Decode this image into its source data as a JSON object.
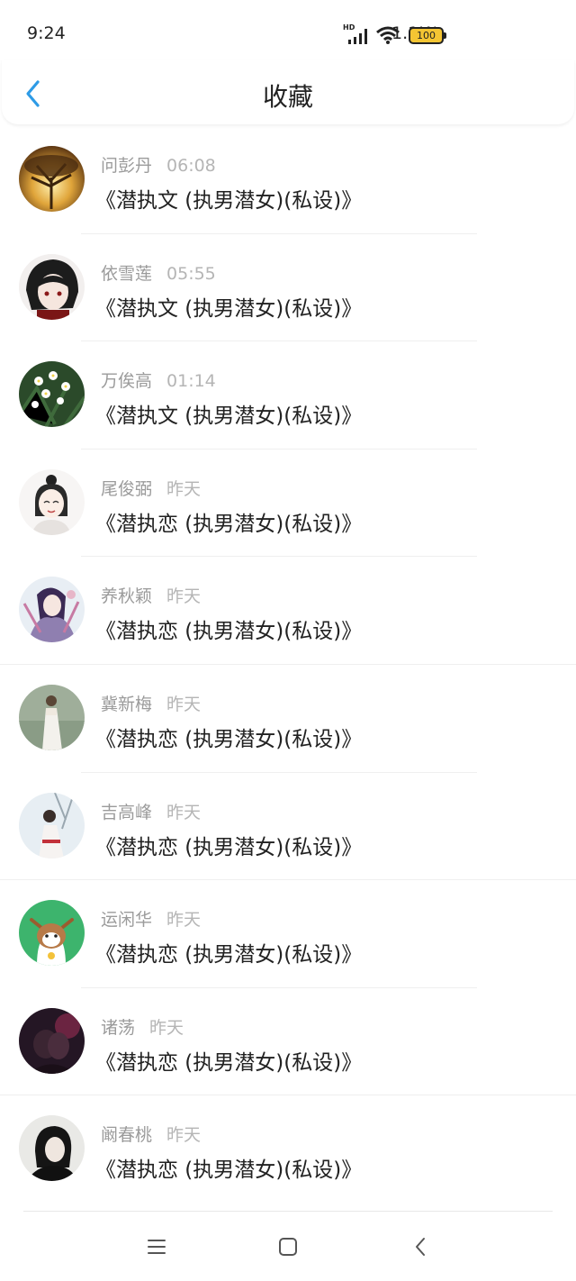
{
  "status_bar": {
    "time": "9:24",
    "network_speed": "1.1K/s",
    "hd": "HD",
    "battery": "100"
  },
  "header": {
    "title": "收藏",
    "back_icon": "chevron-left-icon"
  },
  "colors": {
    "accent": "#2e9be6"
  },
  "items": [
    {
      "name": "问彭丹",
      "time": "06:08",
      "title": "《潜执文 (执男潜女)(私设)》"
    },
    {
      "name": "依雪莲",
      "time": "05:55",
      "title": "《潜执文 (执男潜女)(私设)》"
    },
    {
      "name": "万俟高",
      "time": "01:14",
      "title": "《潜执文 (执男潜女)(私设)》"
    },
    {
      "name": "尾俊弼",
      "time": "昨天",
      "title": "《潜执恋 (执男潜女)(私设)》"
    },
    {
      "name": "养秋颖",
      "time": "昨天",
      "title": "《潜执恋 (执男潜女)(私设)》"
    },
    {
      "name": "冀新梅",
      "time": "昨天",
      "title": "《潜执恋 (执男潜女)(私设)》"
    },
    {
      "name": "吉高峰",
      "time": "昨天",
      "title": "《潜执恋 (执男潜女)(私设)》"
    },
    {
      "name": "运闲华",
      "time": "昨天",
      "title": "《潜执恋 (执男潜女)(私设)》"
    },
    {
      "name": "诸荡",
      "time": "昨天",
      "title": "《潜执恋 (执男潜女)(私设)》"
    },
    {
      "name": "阚春桃",
      "time": "昨天",
      "title": "《潜执恋 (执男潜女)(私设)》"
    }
  ],
  "nav": {
    "menu_icon": "menu-icon",
    "home_icon": "home-square-icon",
    "back_icon": "back-chevron-icon"
  }
}
